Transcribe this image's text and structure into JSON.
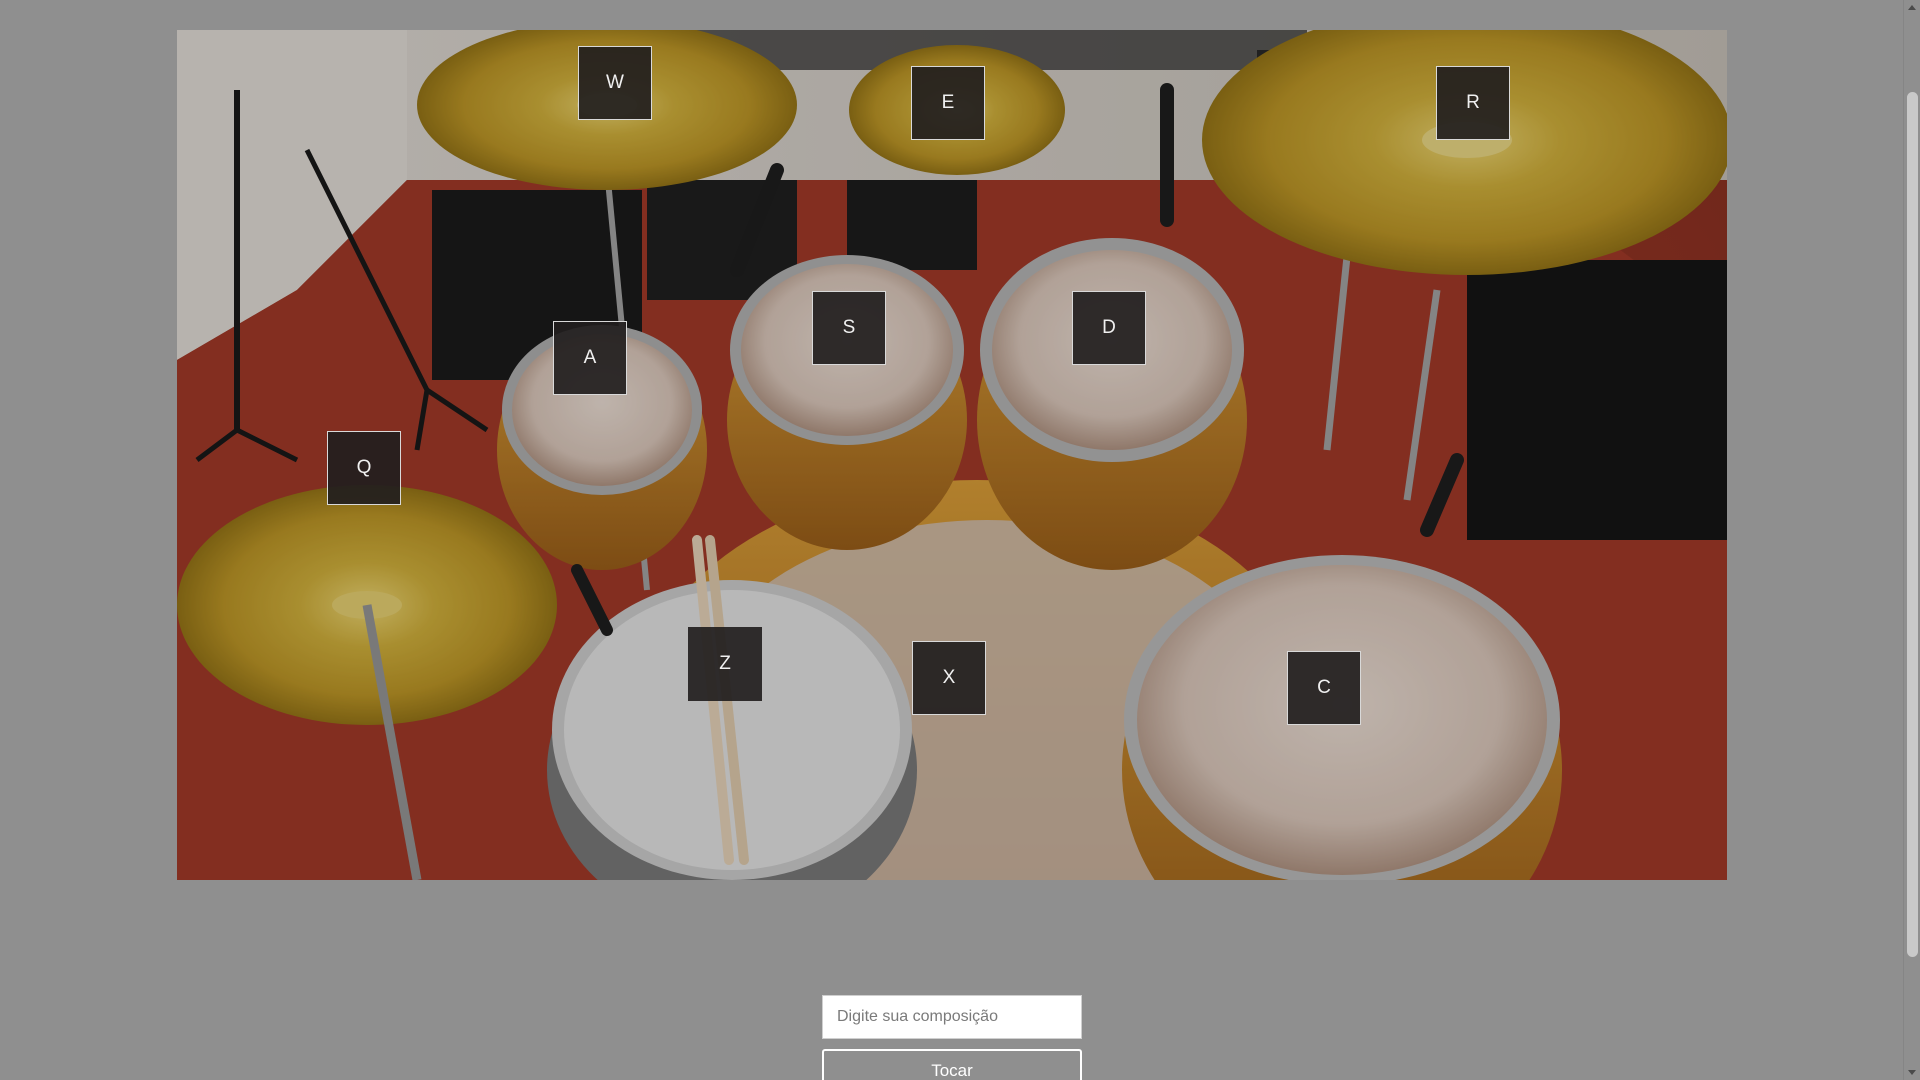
{
  "drum_kit": {
    "keys": [
      {
        "id": "w",
        "label": "W",
        "sound": "crash-left-cymbal"
      },
      {
        "id": "e",
        "label": "E",
        "sound": "splash-cymbal"
      },
      {
        "id": "r",
        "label": "R",
        "sound": "ride-cymbal"
      },
      {
        "id": "a",
        "label": "A",
        "sound": "small-tom"
      },
      {
        "id": "s",
        "label": "S",
        "sound": "mid-tom"
      },
      {
        "id": "d",
        "label": "D",
        "sound": "high-tom"
      },
      {
        "id": "q",
        "label": "Q",
        "sound": "hihat-cymbal"
      },
      {
        "id": "z",
        "label": "Z",
        "sound": "snare"
      },
      {
        "id": "x",
        "label": "X",
        "sound": "kick"
      },
      {
        "id": "c",
        "label": "C",
        "sound": "floor-tom"
      }
    ]
  },
  "composer": {
    "placeholder": "Digite sua composição",
    "value": "",
    "play_label": "Tocar"
  },
  "colors": {
    "page_background": "#8f8f8f",
    "key_background": "#221e1e",
    "key_border": "#d9d9d9",
    "key_text": "#f0f0f0",
    "floor": "#a83c2a",
    "cymbal": "#d4b23a"
  }
}
